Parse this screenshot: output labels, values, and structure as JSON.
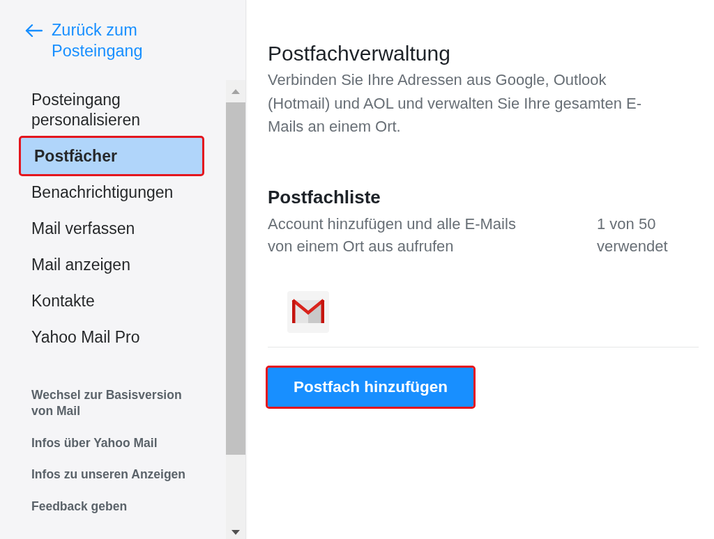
{
  "sidebar": {
    "back_link": {
      "label": "Zurück zum Posteingang"
    },
    "items": [
      {
        "label": "Posteingang personalisieren",
        "selected": false,
        "highlighted": false
      },
      {
        "label": "Postfächer",
        "selected": true,
        "highlighted": true
      },
      {
        "label": "Benachrichtigungen",
        "selected": false,
        "highlighted": false
      },
      {
        "label": "Mail verfassen",
        "selected": false,
        "highlighted": false
      },
      {
        "label": "Mail anzeigen",
        "selected": false,
        "highlighted": false
      },
      {
        "label": "Kontakte",
        "selected": false,
        "highlighted": false
      },
      {
        "label": "Yahoo Mail Pro",
        "selected": false,
        "highlighted": false
      }
    ],
    "footer_links": [
      "Wechsel zur Basisversion von Mail",
      "Infos über Yahoo Mail",
      "Infos zu unseren Anzeigen",
      "Feedback geben"
    ]
  },
  "main": {
    "title": "Postfachverwaltung",
    "description": "Verbinden Sie Ihre Adressen aus Google, Outlook (Hotmail) und AOL und verwalten Sie Ihre gesamten E-Mails an einem Ort.",
    "mailbox_list": {
      "heading": "Postfachliste",
      "description": "Account hinzufügen und alle E-Mails von einem Ort aus aufrufen",
      "usage": "1 von 50 verwendet",
      "accounts": [
        {
          "kind": "gmail"
        }
      ]
    },
    "add_button": {
      "label": "Postfach hinzufügen",
      "highlighted": true
    }
  }
}
